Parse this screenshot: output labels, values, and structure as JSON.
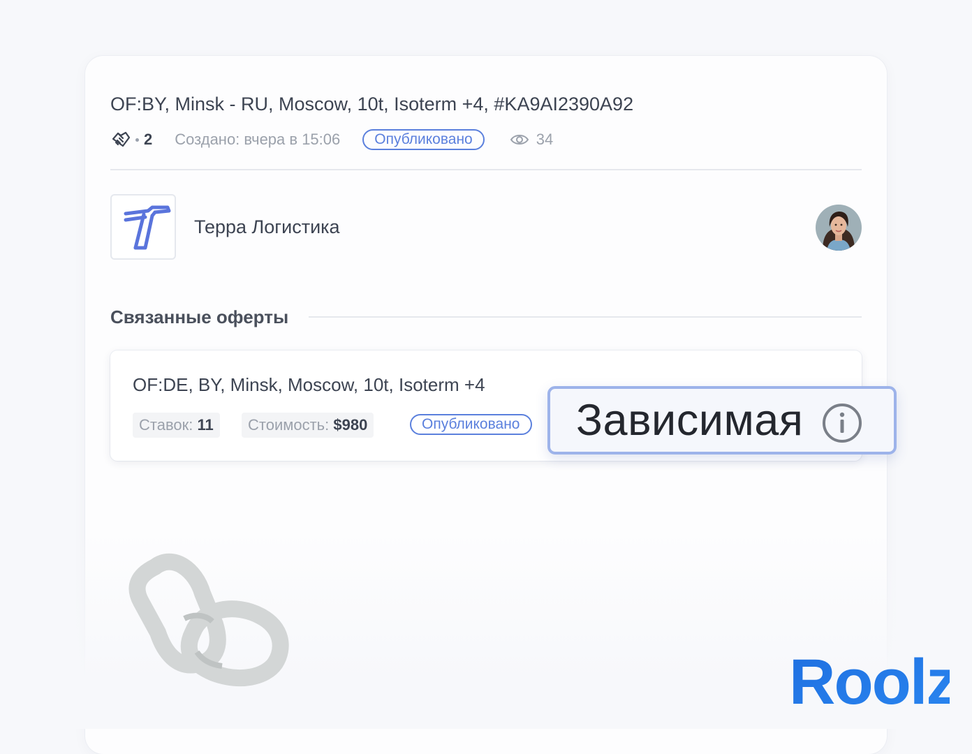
{
  "offer": {
    "title": "OF:BY, Minsk - RU, Moscow, 10t, Isoterm +4, #KA9AI2390A92",
    "handshake_icon": "handshake-icon",
    "handshake_count": "2",
    "created": "Создано: вчера в 15:06",
    "status": "Опубликовано",
    "eye_icon": "eye-icon",
    "views": "34"
  },
  "company": {
    "logo_icon": "company-logo-t-icon",
    "name": "Терра Логистика",
    "avatar": "user-avatar-photo"
  },
  "related": {
    "heading": "Связанные оферты",
    "items": [
      {
        "title": "OF:DE, BY, Minsk, Moscow, 10t, Isoterm +4",
        "bids_label": "Ставок:",
        "bids_value": "11",
        "cost_label": "Стоимость:",
        "cost_value": "$980",
        "status": "Опубликовано"
      }
    ]
  },
  "tooltip": {
    "label": "Зависимая",
    "icon": "info-icon"
  },
  "decor": {
    "chain_icon": "chain-link-icon",
    "brand_logo": "Roolz"
  },
  "colors": {
    "accent_blue": "#5b80dd",
    "tooltip_border": "#9db3ea",
    "brand_blue": "#1f6fe0",
    "chain_gray": "#d3d6d6"
  }
}
